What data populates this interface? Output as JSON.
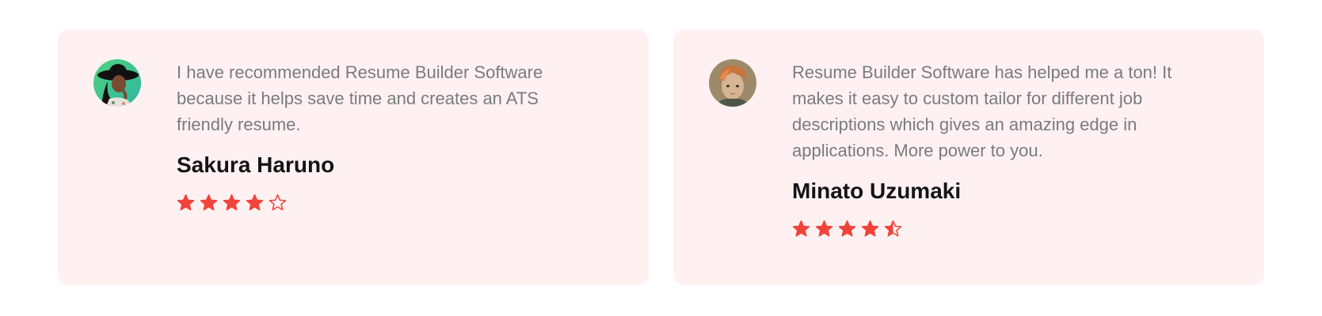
{
  "testimonials": [
    {
      "quote": "I have recommended Resume Builder Software because it helps save time and creates an ATS friendly resume.",
      "author": "Sakura Haruno",
      "rating": 4
    },
    {
      "quote": "Resume Builder Software has helped me a ton! It makes it easy to custom tailor for different job descriptions which gives an amazing edge in applications. More power to you.",
      "author": "Minato Uzumaki",
      "rating": 4.5
    }
  ],
  "colors": {
    "card_background": "#fff1f1",
    "star": "#f0443b",
    "quote_text": "#7b7b7b",
    "author_text": "#141414"
  },
  "icons": {
    "full": "star-icon",
    "half": "half-star-icon",
    "empty": "empty-star-icon"
  }
}
